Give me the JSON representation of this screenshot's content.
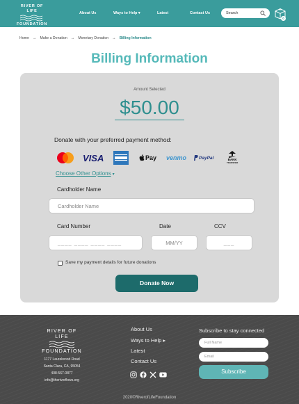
{
  "header": {
    "logo_line1": "RIVER OF LIFE",
    "logo_line2": "FOUNDATION",
    "nav": [
      {
        "label": "About Us"
      },
      {
        "label": "Ways to Help"
      },
      {
        "label": "Latest"
      },
      {
        "label": "Contact Us"
      }
    ],
    "ways_caret": "▾",
    "search_placeholder": "Search",
    "cart_count": "0"
  },
  "breadcrumb": {
    "items": [
      "Home",
      "Make a Donation",
      "Monetary Donation"
    ],
    "current": "Billing Information",
    "separator": "→"
  },
  "page_title": "Billing Information",
  "form": {
    "amount_label": "Amount Selected",
    "amount_value": "$50.00",
    "payment_heading": "Donate with your preferred payment method:",
    "payment_methods": [
      {
        "name": "mastercard-icon"
      },
      {
        "label": "VISA"
      },
      {
        "name": "amex-icon"
      },
      {
        "label": "Pay"
      },
      {
        "label": "venmo"
      },
      {
        "label": "PayPal"
      },
      {
        "label": "BANK",
        "sub": "TRANSFER"
      }
    ],
    "choose_other": "Choose Other Options",
    "choose_caret": "▾",
    "cardholder_label": "Cardholder Name",
    "cardholder_placeholder": "Cardholder Name",
    "card_number_label": "Card Number",
    "card_number_placeholder": "____ ____ ____ ____",
    "date_label": "Date",
    "date_placeholder": "MM/YY",
    "ccv_label": "CCV",
    "ccv_placeholder": "___",
    "save_label": "Save my payment details for future donations",
    "donate_button": "Donate Now"
  },
  "footer": {
    "logo_line1": "RIVER OF LIFE",
    "logo_line2": "FOUNDATION",
    "address": [
      "1177 Laurelwood Road",
      "Santa Clara, CA, 95054",
      "408-567-0877",
      "info@theriverflows.org"
    ],
    "links": [
      {
        "label": "About Us"
      },
      {
        "label": "Ways to Help ▸"
      },
      {
        "label": "Latest"
      },
      {
        "label": "Contact Us"
      }
    ],
    "subscribe_title": "Subscribe to stay connected",
    "fullname_placeholder": "Full Name",
    "email_placeholder": "Email",
    "subscribe_button": "Subscribe",
    "copyright": "2020©RiverofLifeFoundation"
  },
  "colors": {
    "brand_teal": "#3a9c9c",
    "title_teal": "#55b9b9",
    "button_dark_teal": "#1d6b6b",
    "footer_bg": "#4a4a4a"
  }
}
